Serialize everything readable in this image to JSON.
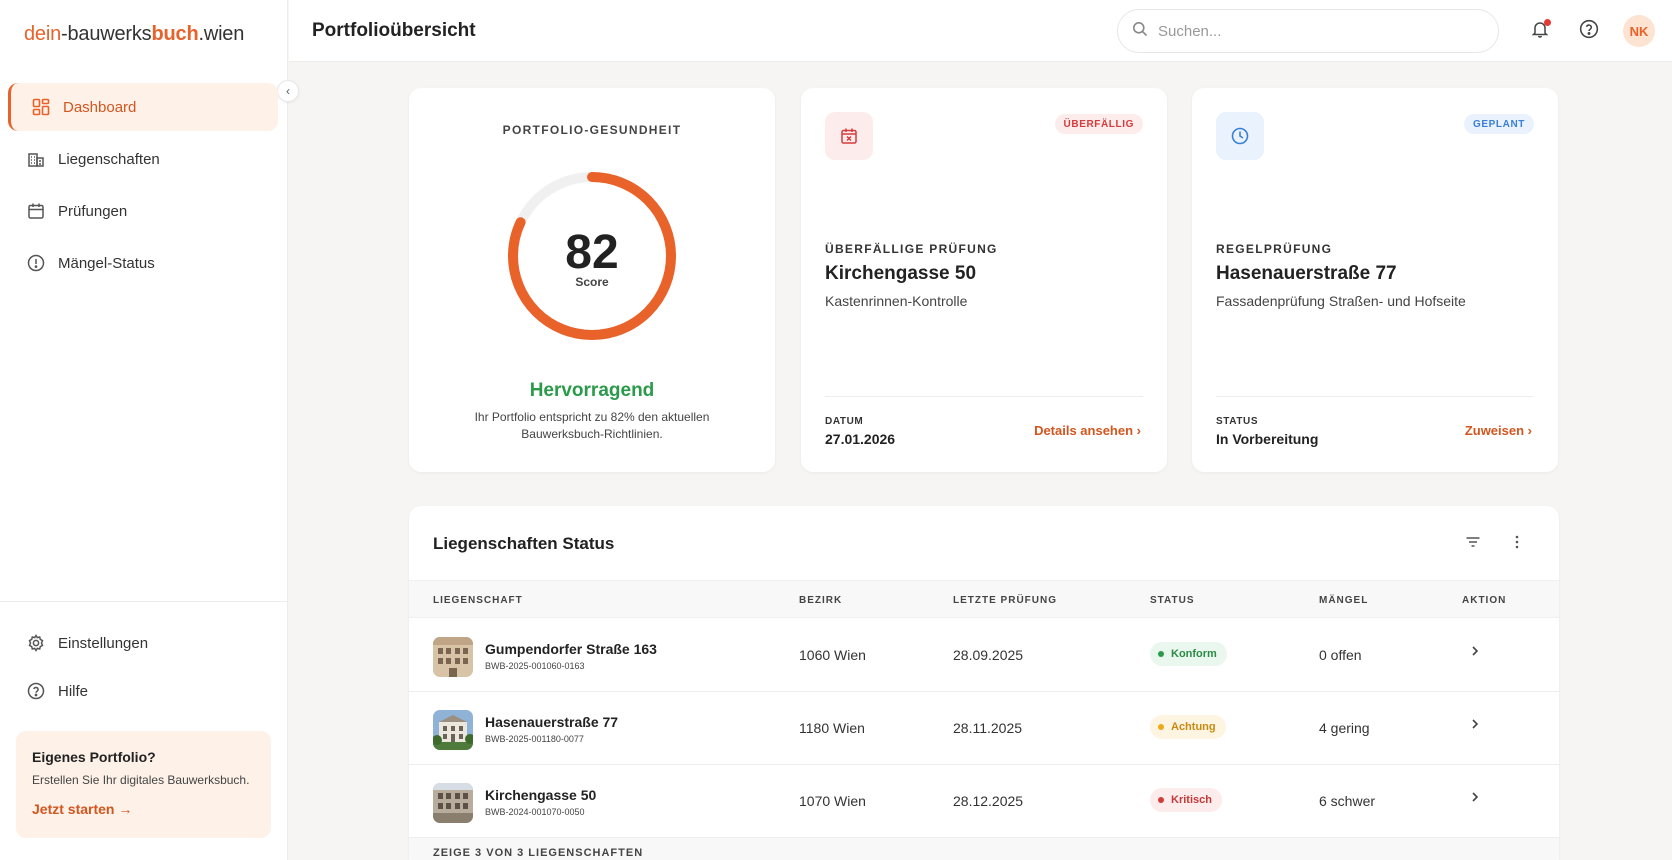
{
  "app": {
    "logo_prefix": "dein",
    "logo_mid": "-bauwerks",
    "logo_bold": "buch",
    "logo_suffix": ".wien"
  },
  "sidebar": {
    "items": [
      {
        "label": "Dashboard",
        "icon": "dashboard-icon",
        "active": true
      },
      {
        "label": "Liegenschaften",
        "icon": "buildings-icon"
      },
      {
        "label": "Prüfungen",
        "icon": "calendar-icon"
      },
      {
        "label": "Mängel-Status",
        "icon": "alert-circle-icon"
      }
    ],
    "bottom_items": [
      {
        "label": "Einstellungen",
        "icon": "gear-icon"
      },
      {
        "label": "Hilfe",
        "icon": "help-icon"
      }
    ],
    "promo": {
      "title": "Eigenes Portfolio?",
      "text": "Erstellen Sie Ihr digitales Bauwerksbuch.",
      "cta": "Jetzt starten →"
    }
  },
  "header": {
    "title": "Portfolioübersicht",
    "search_placeholder": "Suchen...",
    "avatar_initials": "NK"
  },
  "health": {
    "label": "PORTFOLIO-GESUNDHEIT",
    "score": "82",
    "score_fraction": 0.82,
    "score_label": "Score",
    "rating": "Hervorragend",
    "description": "Ihr Portfolio entspricht zu 82% den aktuellen Bauwerksbuch-Richtlinien.",
    "accent": "#e8622a",
    "rating_color": "#2b9a4a"
  },
  "tasks": [
    {
      "badge": "ÜBERFÄLLIG",
      "kicker": "ÜBERFÄLLIGE PRÜFUNG",
      "title": "Kirchengasse 50",
      "subtitle": "Kastenrinnen-Kontrolle",
      "meta_label": "DATUM",
      "meta_value": "27.01.2026",
      "link": "Details ansehen ›",
      "icon": "calendar-x-icon"
    },
    {
      "badge": "GEPLANT",
      "kicker": "REGELPRÜFUNG",
      "title": "Hasenauerstraße 77",
      "subtitle": "Fassadenprüfung Straßen- und Hofseite",
      "meta_label": "STATUS",
      "meta_value": "In Vorbereitung",
      "link": "Zuweisen ›",
      "icon": "clock-icon"
    }
  ],
  "table": {
    "title": "Liegenschaften Status",
    "columns": [
      "LIEGENSCHAFT",
      "BEZIRK",
      "LETZTE PRÜFUNG",
      "STATUS",
      "MÄNGEL",
      "AKTION"
    ],
    "rows": [
      {
        "name": "Gumpendorfer Straße 163",
        "id": "BWB-2025-001060-0163",
        "district": "1060 Wien",
        "last_check": "28.09.2025",
        "status": "Konform",
        "status_color": "green",
        "defects": "0 offen"
      },
      {
        "name": "Hasenauerstraße 77",
        "id": "BWB-2025-001180-0077",
        "district": "1180 Wien",
        "last_check": "28.11.2025",
        "status": "Achtung",
        "status_color": "yellow",
        "defects": "4 gering"
      },
      {
        "name": "Kirchengasse 50",
        "id": "BWB-2024-001070-0050",
        "district": "1070 Wien",
        "last_check": "28.12.2025",
        "status": "Kritisch",
        "status_color": "red",
        "defects": "6 schwer"
      }
    ],
    "footer": "ZEIGE 3 VON 3 LIEGENSCHAFTEN"
  }
}
